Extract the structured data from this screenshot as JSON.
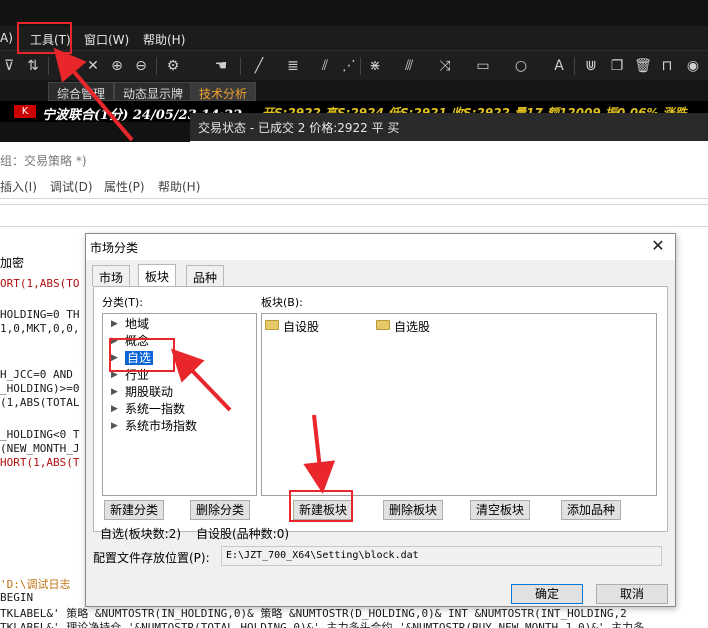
{
  "app": {
    "menu": [
      "A)",
      "工具(T)",
      "窗口(W)",
      "帮助(H)"
    ],
    "tabs": [
      "综合管理",
      "动态显示牌",
      "技术分析"
    ],
    "quote_text": "宁波联合(1分) 24/05/23 14:22",
    "quote_more": "开S:2922 高S:2924 低S:2921 收S:2922 量17 额12009 振0.06% 涨跌",
    "status_tip": "交易状态 - 已成交 2 价格:2922 平 买"
  },
  "editor": {
    "title": "组：交易策略 *)",
    "menu": [
      "插入(I)",
      "调试(D)",
      "属性(P)",
      "帮助(H)"
    ],
    "panel_head": "加密",
    "code_lines": [
      {
        "text": "ORT(1,ABS(TO",
        "color": "#b01010"
      },
      {
        "text": "HOLDING=0 TH",
        "color": "#1a1a1a"
      },
      {
        "text": "1,0,MKT,0,0,",
        "color": "#1a1a1a"
      },
      {
        "text": "H_JCC=0 AND",
        "color": "#1a1a1a"
      },
      {
        "text": "_HOLDING)>=0",
        "color": "#1a1a1a"
      },
      {
        "text": "(1,ABS(TOTAL",
        "color": "#1a1a1a"
      },
      {
        "text": "_HOLDING<0 T",
        "color": "#1a1a1a"
      },
      {
        "text": "(NEW_MONTH_J",
        "color": "#1a1a1a"
      },
      {
        "text": "HORT(1,ABS(T",
        "color": "#b01010"
      },
      {
        "text": "'D:\\调试日志",
        "color": "#c07010"
      },
      {
        "text": " BEGIN",
        "color": "#1a1a1a"
      },
      {
        "text": "TKLABEL&' 策略 &NUMTOSTR(IN_HOLDING,0)& 策略 &NUMTOSTR(D_HOLDING,0)& INT &NUMTOSTR(INT_HOLDING,2",
        "color": "#1a1a1a"
      },
      {
        "text": "TKLABEL&' 理论净持仓 '&NUMTOSTR(TOTAL_HOLDING,0)&' 主力多头合约 '&NUMTOSTR(BUY_NEW_MONTH_J,0)&' 主力多",
        "color": "#1a1a1a"
      }
    ]
  },
  "dialog": {
    "title": "市场分类",
    "close_glyph": "✕",
    "tabs": [
      "市场",
      "板块",
      "品种"
    ],
    "category_label": "分类(T):",
    "block_label": "板块(B):",
    "categories": [
      "地域",
      "概念",
      "自选",
      "行业",
      "期股联动",
      "系统一指数",
      "系统市场指数"
    ],
    "selected_category": "自选",
    "blocks": [
      "自设股",
      "自选股"
    ],
    "buttons": {
      "new_category": "新建分类",
      "delete_category": "删除分类",
      "new_block": "新建板块",
      "delete_block": "删除板块",
      "clear_block": "清空板块",
      "add_variety": "添加品种",
      "ok": "确定",
      "cancel": "取消"
    },
    "info_left": "自选(板块数:2)",
    "info_right": "自设股(品种数:0)",
    "path_label": "配置文件存放位置(P):",
    "path_value": "E:\\JZT_700_X64\\Setting\\block.dat"
  },
  "colors": {
    "highlight": "#e8262b",
    "selection": "#0a64d6",
    "dark_bg": "#1c1c1c"
  }
}
